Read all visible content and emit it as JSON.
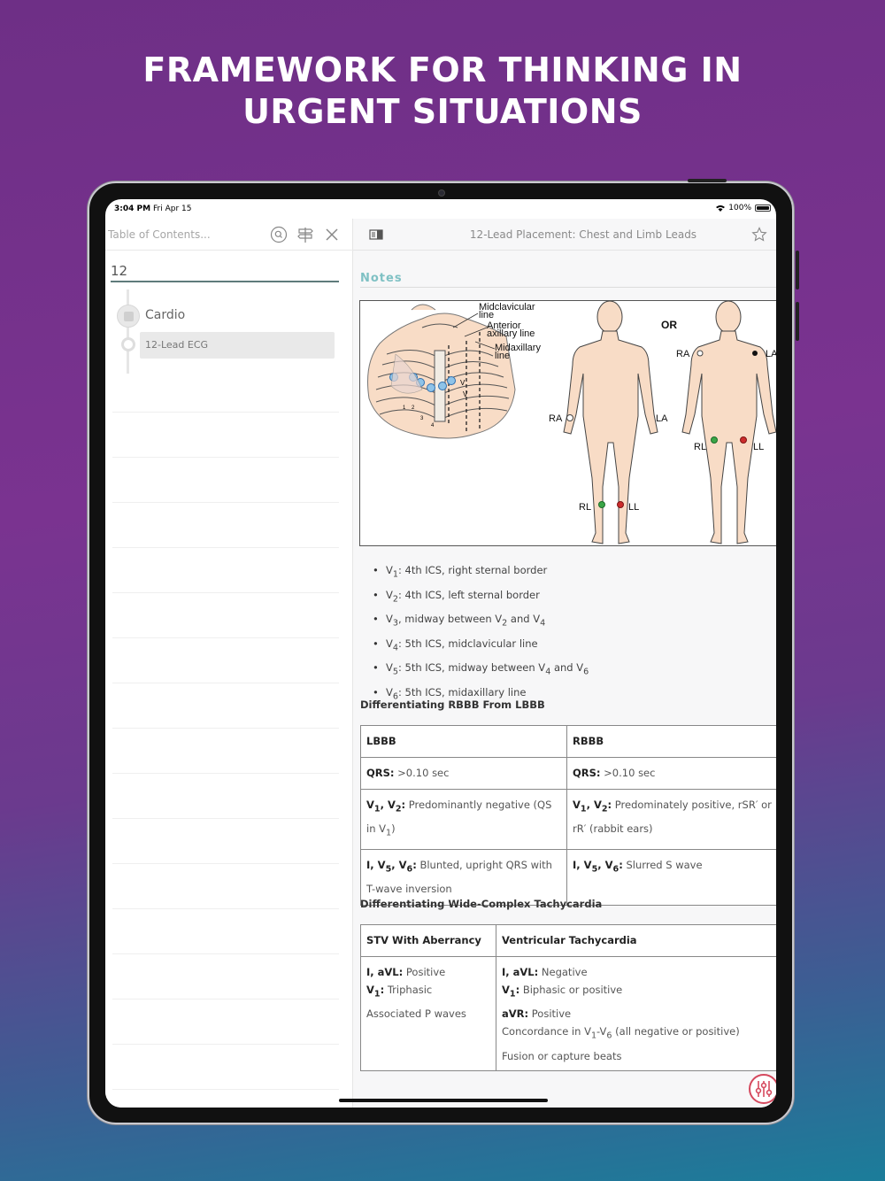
{
  "headline": {
    "line1": "FRAMEWORK FOR THINKING IN",
    "line2": "URGENT SITUATIONS"
  },
  "status": {
    "time": "3:04 PM",
    "date": "Fri Apr 15",
    "battery": "100%"
  },
  "left": {
    "search_placeholder": "Table of Contents...",
    "query": "12",
    "category": "Cardio",
    "item": "12-Lead ECG"
  },
  "doc": {
    "title": "12-Lead Placement: Chest and Limb Leads",
    "notes_heading": "Notes",
    "figure": {
      "chest_labels": [
        "Midclavicular line",
        "Anterior axillary line",
        "Midaxillary line"
      ],
      "leads": [
        "RA",
        "LA",
        "RL",
        "LL"
      ],
      "or": "OR",
      "electrode_colors": {
        "green": "#3aa547",
        "red": "#cc2c2c",
        "blue": "#4f9fd6"
      }
    },
    "bullets": [
      {
        "pre": "V",
        "sub": "1",
        "text": ": 4th ICS, right sternal border"
      },
      {
        "pre": "V",
        "sub": "2",
        "text": ": 4th ICS, left sternal border"
      },
      {
        "pre": "V",
        "sub": "3",
        "text": ", midway between V",
        "sub2": "2",
        "mid": " and V",
        "sub3": "4"
      },
      {
        "pre": "V",
        "sub": "4",
        "text": ": 5th ICS, midclavicular line"
      },
      {
        "pre": "V",
        "sub": "5",
        "text": ": 5th ICS, midway between V",
        "sub2": "4",
        "mid": " and V",
        "sub3": "6"
      },
      {
        "pre": "V",
        "sub": "6",
        "text": ": 5th ICS, midaxillary line"
      }
    ],
    "section1": "Differentiating RBBB From LBBB",
    "table1": {
      "headers": [
        "LBBB",
        "RBBB"
      ],
      "rows": [
        [
          "QRS: >0.10 sec",
          "QRS: >0.10 sec"
        ],
        [
          "V1, V2: Predominantly negative (QS in V1)",
          "V1, V2: Predominately positive, rSR′ or rR′ (rabbit ears)"
        ],
        [
          "I, V5, V6: Blunted, upright QRS with T-wave inversion",
          "I, V5, V6: Slurred S wave"
        ]
      ]
    },
    "section2": "Differentiating Wide-Complex Tachycardia",
    "table2": {
      "headers": [
        "STV With Aberrancy",
        "Ventricular Tachycardia"
      ],
      "left": {
        "l1b": "I, aVL:",
        "l1": " Positive",
        "l2b": "V1:",
        "l2": " Triphasic",
        "l3": "Associated P waves"
      },
      "right": {
        "l1b": "I, aVL:",
        "l1": " Negative",
        "l2b": "V1:",
        "l2": " Biphasic or positive",
        "l3b": "aVR:",
        "l3": " Positive",
        "l4": "Concordance in V1-V6 (all negative or positive)",
        "l5": "Fusion or capture beats"
      }
    }
  },
  "colors": {
    "accent": "#7fc1c4",
    "fab": "#d5495e"
  }
}
